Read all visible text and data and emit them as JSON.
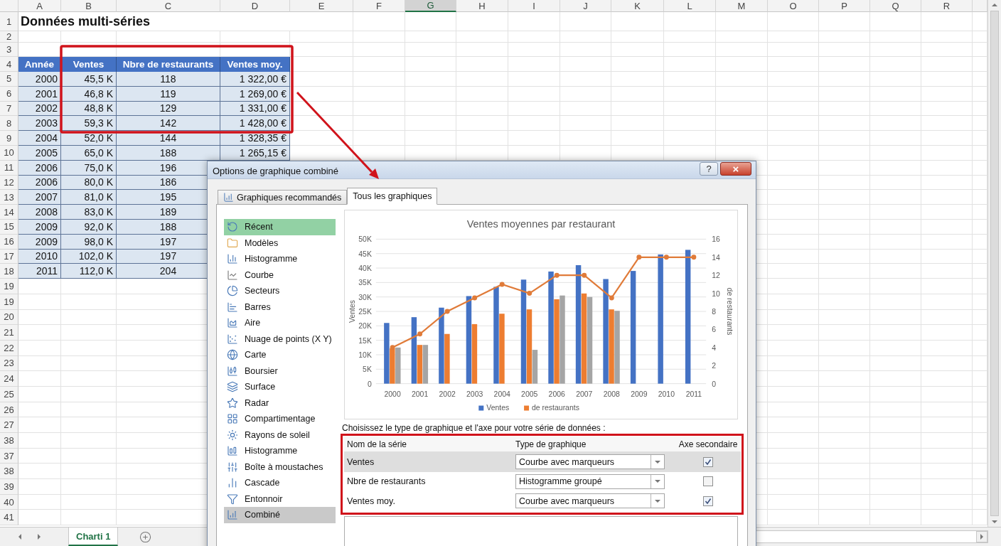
{
  "sheet": {
    "columns": [
      {
        "label": "A",
        "selected": false
      },
      {
        "label": "B",
        "selected": false
      },
      {
        "label": "C",
        "selected": false
      },
      {
        "label": "D",
        "selected": false
      },
      {
        "label": "E",
        "selected": false
      },
      {
        "label": "F",
        "selected": false
      },
      {
        "label": "G",
        "selected": true
      },
      {
        "label": "H",
        "selected": false
      },
      {
        "label": "I",
        "selected": false
      },
      {
        "label": "J",
        "selected": false
      },
      {
        "label": "K",
        "selected": false
      },
      {
        "label": "L",
        "selected": false
      },
      {
        "label": "M",
        "selected": false
      },
      {
        "label": "O",
        "selected": false
      },
      {
        "label": "P",
        "selected": false
      },
      {
        "label": "Q",
        "selected": false
      },
      {
        "label": "R",
        "selected": false
      }
    ],
    "row_labels": [
      "1",
      "2",
      "3",
      "4",
      "5",
      "6",
      "7",
      "8",
      "9",
      "10",
      "11",
      "12",
      "13",
      "14",
      "15",
      "16",
      "17",
      "18",
      "19",
      "19",
      "20",
      "21",
      "22",
      "23",
      "24",
      "25",
      "26",
      "27",
      "38",
      "37",
      "38",
      "39",
      "40",
      "41"
    ],
    "title": "Données multi-séries",
    "table": {
      "columns": [
        "Année",
        "Ventes",
        "Nbre de restaurants",
        "Ventes moy."
      ],
      "rows": [
        [
          "2000",
          "45,5 K",
          "118",
          "1 322,00 €"
        ],
        [
          "2001",
          "46,8 K",
          "119",
          "1 269,00 €"
        ],
        [
          "2002",
          "48,8 K",
          "129",
          "1 331,00 €"
        ],
        [
          "2003",
          "59,3 K",
          "142",
          "1 428,00 €"
        ],
        [
          "2004",
          "52,0 K",
          "144",
          "1 328,35 €"
        ],
        [
          "2005",
          "65,0 K",
          "188",
          "1 265,15 €"
        ],
        [
          "2006",
          "75,0 K",
          "196"
        ],
        [
          "2006",
          "80,0 K",
          "186"
        ],
        [
          "2007",
          "81,0 K",
          "195"
        ],
        [
          "2008",
          "83,0 K",
          "189"
        ],
        [
          "2009",
          "92,0 K",
          "188"
        ],
        [
          "2009",
          "98,0 K",
          "197"
        ],
        [
          "2010",
          "102,0 K",
          "197"
        ],
        [
          "2011",
          "112,0 K",
          "204"
        ]
      ]
    }
  },
  "sheet_tabs": [
    {
      "label": "Charti 1",
      "selected": true
    }
  ],
  "dialog": {
    "title": "Options de graphique combiné",
    "help_label": "?",
    "close_label": "×",
    "tabs": [
      {
        "label": "Graphiques recommandés",
        "selected": false
      },
      {
        "label": "Tous les graphiques",
        "selected": true
      }
    ],
    "chart_types": [
      {
        "label": "Récent",
        "kind": "recent",
        "selected": false,
        "highlighted": true
      },
      {
        "label": "Modèles",
        "kind": "templates",
        "selected": false,
        "highlighted": false
      },
      {
        "label": "Histogramme",
        "kind": "column",
        "selected": false,
        "highlighted": false
      },
      {
        "label": "Courbe",
        "kind": "line",
        "selected": false,
        "highlighted": false
      },
      {
        "label": "Secteurs",
        "kind": "pie",
        "selected": false,
        "highlighted": false
      },
      {
        "label": "Barres",
        "kind": "bar",
        "selected": false,
        "highlighted": false
      },
      {
        "label": "Aire",
        "kind": "area",
        "selected": false,
        "highlighted": false
      },
      {
        "label": "Nuage de points (X Y)",
        "kind": "scatter",
        "selected": false,
        "highlighted": false
      },
      {
        "label": "Carte",
        "kind": "map",
        "selected": false,
        "highlighted": false
      },
      {
        "label": "Boursier",
        "kind": "stock",
        "selected": false,
        "highlighted": false
      },
      {
        "label": "Surface",
        "kind": "surface",
        "selected": false,
        "highlighted": false
      },
      {
        "label": "Radar",
        "kind": "radar",
        "selected": false,
        "highlighted": false
      },
      {
        "label": "Compartimentage",
        "kind": "treemap",
        "selected": false,
        "highlighted": false
      },
      {
        "label": "Rayons de soleil",
        "kind": "sunburst",
        "selected": false,
        "highlighted": false
      },
      {
        "label": "Histogramme",
        "kind": "histogram",
        "selected": false,
        "highlighted": false
      },
      {
        "label": "Boîte à moustaches",
        "kind": "boxplot",
        "selected": false,
        "highlighted": false
      },
      {
        "label": "Cascade",
        "kind": "waterfall",
        "selected": false,
        "highlighted": false
      },
      {
        "label": "Entonnoir",
        "kind": "funnel",
        "selected": false,
        "highlighted": false
      },
      {
        "label": "Combiné",
        "kind": "combo",
        "selected": true,
        "highlighted": false
      }
    ],
    "chart": {
      "chart_data": {
        "type": "bar",
        "title": "Ventes moyennes par restaurant",
        "ylabel": "Ventes",
        "y2label": "de restaurants",
        "categories": [
          "2000",
          "2001",
          "2002",
          "2003",
          "2004",
          "2005",
          "2006",
          "2007",
          "2008",
          "2009",
          "2010",
          "2011"
        ],
        "series": [
          {
            "name": "Ventes",
            "color": "#4472c4",
            "values": [
              21000,
              23000,
              26300,
              30300,
              33500,
              36000,
              38800,
              41000,
              36200,
              39000,
              44700,
              46300
            ]
          },
          {
            "name": "de restaurants",
            "color": "#ed7d31",
            "values": [
              12200,
              13400,
              17200,
              20600,
              24200,
              25700,
              29200,
              31200,
              25700,
              null,
              null,
              null
            ]
          },
          {
            "color": "#a5a5a5",
            "values": [
              12500,
              13400,
              null,
              null,
              null,
              11700,
              30500,
              30000,
              25200,
              null,
              null,
              null
            ]
          },
          {
            "type": "line",
            "axis": "y2",
            "marker": "circle",
            "color": "#e07b39",
            "values": [
              4,
              5.5,
              8,
              9.5,
              11,
              10,
              12,
              12,
              9.5,
              14,
              14,
              14
            ]
          }
        ],
        "grid": true,
        "legend": "bottom",
        "ylim": [
          0,
          50000
        ],
        "y2lim": [
          0,
          16
        ],
        "yticks": [
          {
            "value": 0,
            "label": "0"
          },
          {
            "value": 5000,
            "label": "5K"
          },
          {
            "value": 10000,
            "label": "10K"
          },
          {
            "value": 15000,
            "label": "15K"
          },
          {
            "value": 20000,
            "label": "20K"
          },
          {
            "value": 25000,
            "label": "25K"
          },
          {
            "value": 30000,
            "label": "30K"
          },
          {
            "value": 35000,
            "label": "35K"
          },
          {
            "value": 40000,
            "label": "40K"
          },
          {
            "value": 45000,
            "label": "45K"
          },
          {
            "value": 50000,
            "label": "50K"
          }
        ],
        "y2ticks": [
          0,
          2,
          4,
          6,
          8,
          10,
          12,
          14,
          16
        ]
      }
    },
    "prompt": "Choisissez le type de graphique et l'axe pour votre série de données :",
    "series_table": {
      "columns": [
        "Nom de la série",
        "Type de graphique",
        "Axe secondaire"
      ],
      "rows": [
        {
          "name": "Ventes",
          "type": "Courbe avec marqueurs",
          "secondary_axis": true,
          "selected": true
        },
        {
          "name": "Nbre de restaurants",
          "type": "Histogramme groupé",
          "secondary_axis": false,
          "selected": false
        },
        {
          "name": "Ventes moy.",
          "type": "Courbe avec marqueurs",
          "secondary_axis": true,
          "selected": false
        }
      ]
    }
  }
}
